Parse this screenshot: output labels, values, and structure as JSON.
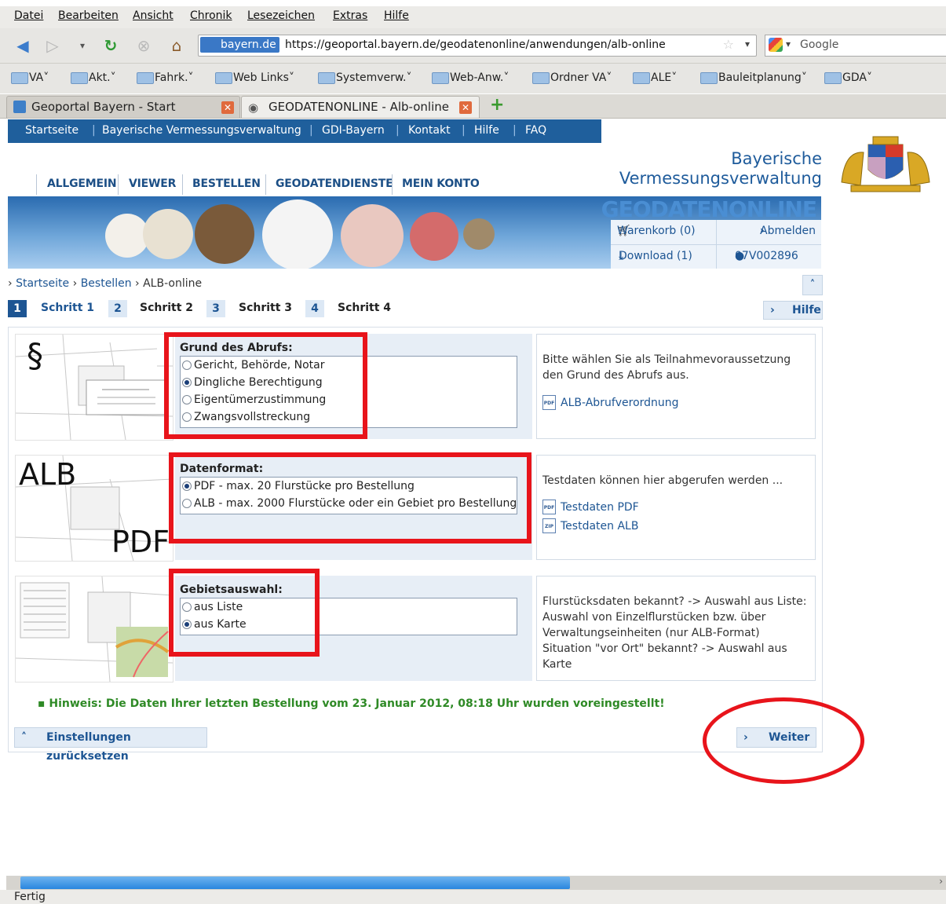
{
  "browser": {
    "menu": [
      "Datei",
      "Bearbeiten",
      "Ansicht",
      "Chronik",
      "Lesezeichen",
      "Extras",
      "Hilfe"
    ],
    "url_site": "bayern.de",
    "url": "https://geoportal.bayern.de/geodatenonline/anwendungen/alb-online",
    "search_engine": "Google",
    "bookmarks": [
      "VA",
      "Akt.",
      "Fahrk.",
      "Web Links",
      "Systemverw.",
      "Web-Anw.",
      "Ordner VA",
      "ALE",
      "Bauleitplanung",
      "GDA"
    ],
    "tabs": [
      {
        "title": "Geoportal Bayern - Start"
      },
      {
        "title": "GEODATENONLINE - Alb-online"
      }
    ],
    "status": "Fertig"
  },
  "topnav": [
    "Startseite",
    "Bayerische Vermessungsverwaltung",
    "GDI-Bayern",
    "Kontakt",
    "Hilfe",
    "FAQ"
  ],
  "brand": {
    "line1": "Bayerische",
    "line2": "Vermessungsverwaltung",
    "banner": "GEODATENONLINE"
  },
  "mainnav": [
    "ALLGEMEIN",
    "VIEWER",
    "BESTELLEN",
    "GEODATENDIENSTE",
    "MEIN KONTO"
  ],
  "account": {
    "cart": "Warenkorb (0)",
    "logout": "Abmelden",
    "download": "Download (1)",
    "user": "07V002896"
  },
  "breadcrumb": [
    "Startseite",
    "Bestellen",
    "ALB-online"
  ],
  "steps": [
    {
      "num": "1",
      "label": "Schritt 1"
    },
    {
      "num": "2",
      "label": "Schritt 2"
    },
    {
      "num": "3",
      "label": "Schritt 3"
    },
    {
      "num": "4",
      "label": "Schritt 4"
    }
  ],
  "help_button": "Hilfe",
  "sections": {
    "grund": {
      "image_text": "§",
      "legend": "Grund des Abrufs:",
      "options": [
        "Gericht, Behörde, Notar",
        "Dingliche Berechtigung",
        "Eigentümerzustimmung",
        "Zwangsvollstreckung"
      ],
      "selected": 1,
      "info": "Bitte wählen Sie als Teilnahmevoraussetzung den Grund des Abrufs aus.",
      "links": [
        {
          "label": "ALB-Abrufverordnung",
          "icon": "PDF"
        }
      ]
    },
    "format": {
      "image_text_top": "ALB",
      "image_text_bottom": "PDF",
      "legend": "Datenformat:",
      "options": [
        "PDF - max. 20 Flurstücke pro Bestellung",
        "ALB - max. 2000 Flurstücke oder ein Gebiet pro Bestellung"
      ],
      "selected": 0,
      "info": "Testdaten können hier abgerufen werden ...",
      "links": [
        {
          "label": "Testdaten PDF",
          "icon": "PDF"
        },
        {
          "label": "Testdaten ALB",
          "icon": "ZIP"
        }
      ]
    },
    "gebiet": {
      "legend": "Gebietsauswahl:",
      "options": [
        "aus Liste",
        "aus Karte"
      ],
      "selected": 1,
      "info_lines": [
        "Flurstücksdaten bekannt? -> Auswahl aus Liste:",
        "Auswahl von Einzelflurstücken bzw. über",
        "Verwaltungseinheiten (nur ALB-Format)",
        "Situation \"vor Ort\" bekannt? -> Auswahl aus Karte"
      ]
    }
  },
  "hint": "Hinweis: Die Daten Ihrer letzten Bestellung vom 23. Januar 2012, 08:18 Uhr wurden voreingestellt!",
  "buttons": {
    "reset": "Einstellungen zurücksetzen",
    "next": "Weiter"
  },
  "colors": {
    "accent": "#1d5593",
    "nav": "#1f5f9c",
    "hint": "#2f8a26",
    "annotation": "#e8141b"
  }
}
